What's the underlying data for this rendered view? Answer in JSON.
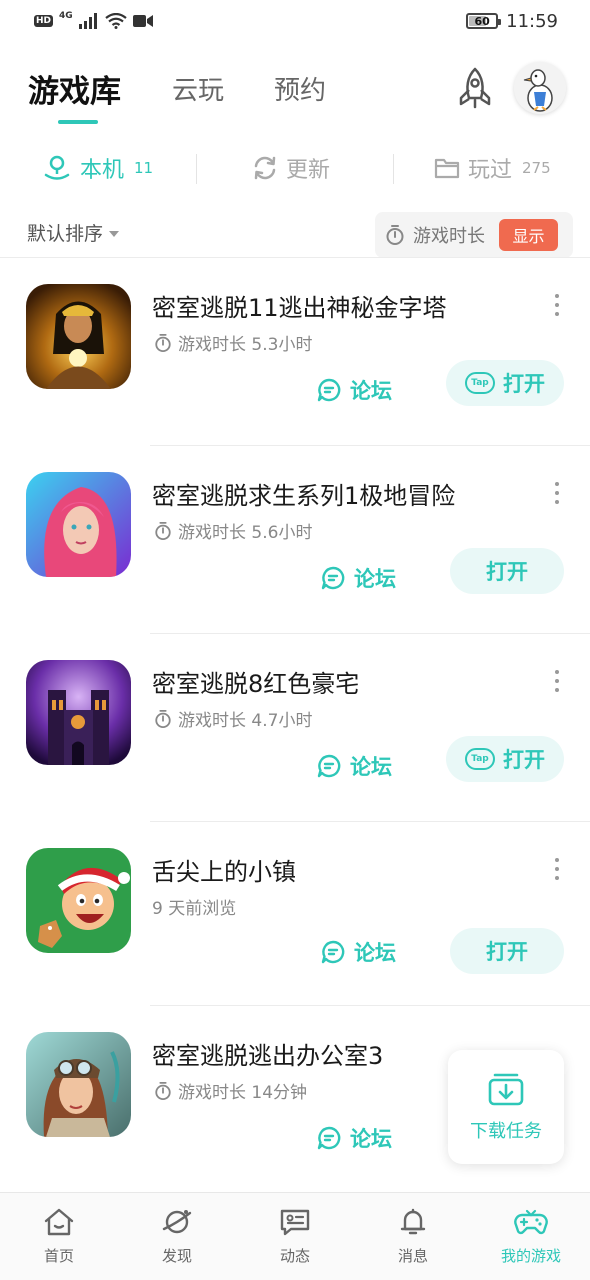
{
  "status_bar": {
    "hd": "HD",
    "network": "4G",
    "battery": "60",
    "time": "11:59"
  },
  "header": {
    "tabs": [
      {
        "label": "游戏库",
        "active": true
      },
      {
        "label": "云玩",
        "active": false
      },
      {
        "label": "预约",
        "active": false
      }
    ],
    "rocket_icon": "rocket-icon",
    "avatar_icon": "goose-avatar"
  },
  "subtabs": [
    {
      "label": "本机",
      "count": "11",
      "icon": "device-icon",
      "active": true
    },
    {
      "label": "更新",
      "count": "",
      "icon": "refresh-icon",
      "active": false
    },
    {
      "label": "玩过",
      "count": "275",
      "icon": "folder-icon",
      "active": false
    }
  ],
  "sortbar": {
    "sort_label": "默认排序",
    "duration_label": "游戏时长",
    "show_button": "显示"
  },
  "games": [
    {
      "title": "密室逃脱11逃出神秘金字塔",
      "subtitle": "游戏时长 5.3小时",
      "has_timer": true,
      "forum": "论坛",
      "open": "打开",
      "tap_badge": "Tap",
      "theme": "pyramid"
    },
    {
      "title": "密室逃脱求生系列1极地冒险",
      "subtitle": "游戏时长 5.6小时",
      "has_timer": true,
      "forum": "论坛",
      "open": "打开",
      "tap_badge": "",
      "theme": "pink-hair"
    },
    {
      "title": "密室逃脱8红色豪宅",
      "subtitle": "游戏时长 4.7小时",
      "has_timer": true,
      "forum": "论坛",
      "open": "打开",
      "tap_badge": "Tap",
      "theme": "cathedral"
    },
    {
      "title": "舌尖上的小镇",
      "subtitle": "9 天前浏览",
      "has_timer": false,
      "forum": "论坛",
      "open": "打开",
      "tap_badge": "",
      "theme": "christmas"
    },
    {
      "title": "密室逃脱逃出办公室3",
      "subtitle": "游戏时长 14分钟",
      "has_timer": true,
      "forum": "论坛",
      "open": "",
      "tap_badge": "",
      "theme": "aviator"
    }
  ],
  "download_float": {
    "label": "下载任务",
    "icon": "download-tray-icon"
  },
  "bottom_nav": [
    {
      "label": "首页",
      "icon": "home-icon",
      "active": false
    },
    {
      "label": "发现",
      "icon": "planet-icon",
      "active": false
    },
    {
      "label": "动态",
      "icon": "message-card-icon",
      "active": false
    },
    {
      "label": "消息",
      "icon": "bell-icon",
      "active": false
    },
    {
      "label": "我的游戏",
      "icon": "gamepad-icon",
      "active": true
    }
  ],
  "colors": {
    "accent": "#2ec7b8",
    "show_button": "#f06a4f"
  }
}
